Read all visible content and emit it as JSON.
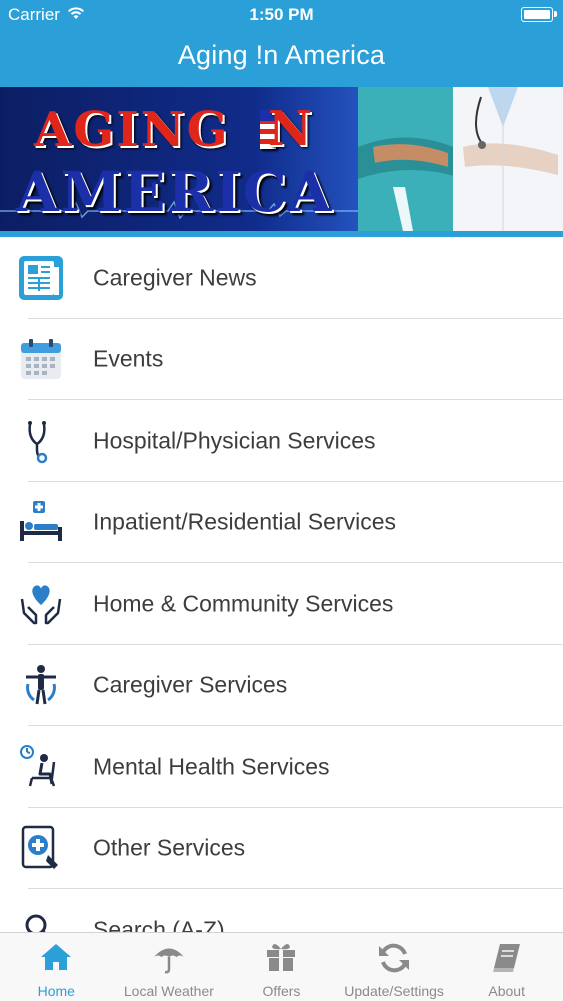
{
  "status": {
    "carrier": "Carrier",
    "time": "1:50 PM"
  },
  "nav": {
    "title": "Aging !n America"
  },
  "banner": {
    "word_aging": "AGING",
    "word_n": "N",
    "word_america": "AMERICA"
  },
  "menu": [
    {
      "label": "Caregiver News",
      "icon": "newspaper-icon"
    },
    {
      "label": "Events",
      "icon": "calendar-icon"
    },
    {
      "label": "Hospital/Physician Services",
      "icon": "stethoscope-icon"
    },
    {
      "label": "Inpatient/Residential Services",
      "icon": "hospital-bed-icon"
    },
    {
      "label": "Home & Community Services",
      "icon": "heart-hands-icon"
    },
    {
      "label": "Caregiver Services",
      "icon": "person-care-icon"
    },
    {
      "label": "Mental Health Services",
      "icon": "therapy-chair-icon"
    },
    {
      "label": "Other Services",
      "icon": "tablet-plus-icon"
    },
    {
      "label": "Search (A-Z)",
      "icon": "search-icon"
    }
  ],
  "tabs": [
    {
      "label": "Home",
      "icon": "home-icon",
      "active": true
    },
    {
      "label": "Local Weather",
      "icon": "umbrella-icon",
      "active": false
    },
    {
      "label": "Offers",
      "icon": "gift-icon",
      "active": false
    },
    {
      "label": "Update/Settings",
      "icon": "refresh-icon",
      "active": false
    },
    {
      "label": "About",
      "icon": "book-icon",
      "active": false
    }
  ],
  "colors": {
    "accent": "#2a9fd8",
    "tab_inactive": "#8a8a8a",
    "text": "#3d3d3d"
  }
}
